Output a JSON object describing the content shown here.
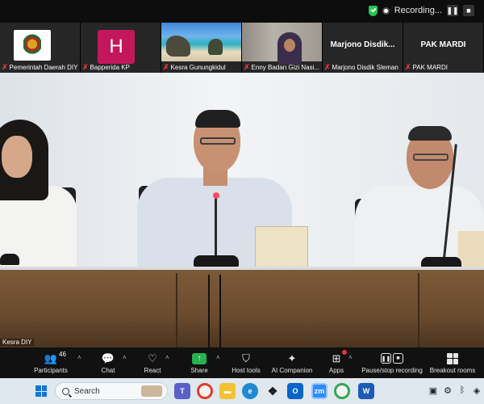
{
  "recording": {
    "status_text": "Recording..."
  },
  "thumbnails": [
    {
      "name": "Pemerintah Daerah DIY",
      "muted": true,
      "kind": "logo"
    },
    {
      "name": "Bapperida KP",
      "muted": true,
      "kind": "avatar",
      "avatar_letter": "H",
      "avatar_color": "#c2185b"
    },
    {
      "name": "Kesra Gunungkidul",
      "muted": true,
      "kind": "video"
    },
    {
      "name": "Enny Badan Gizi Nasi...",
      "muted": true,
      "kind": "video"
    },
    {
      "name": "Marjono Disdik Sleman",
      "muted": true,
      "kind": "name",
      "big_name": "Marjono Disdik..."
    },
    {
      "name": "PAK MARDI",
      "muted": true,
      "kind": "name",
      "big_name": "PAK MARDI"
    }
  ],
  "main_video": {
    "label": "Kesra DIY"
  },
  "toolbar": {
    "participants_label": "Participants",
    "participants_count": "46",
    "chat_label": "Chat",
    "react_label": "React",
    "share_label": "Share",
    "host_tools_label": "Host tools",
    "ai_companion_label": "AI Companion",
    "apps_label": "Apps",
    "pause_recording_label": "Pause/stop recording",
    "breakout_label": "Breakout rooms"
  },
  "taskbar": {
    "search_placeholder": "Search"
  },
  "colors": {
    "share_green": "#26b24f",
    "muted_red": "#e0383e",
    "recording_shield": "#23c552"
  }
}
